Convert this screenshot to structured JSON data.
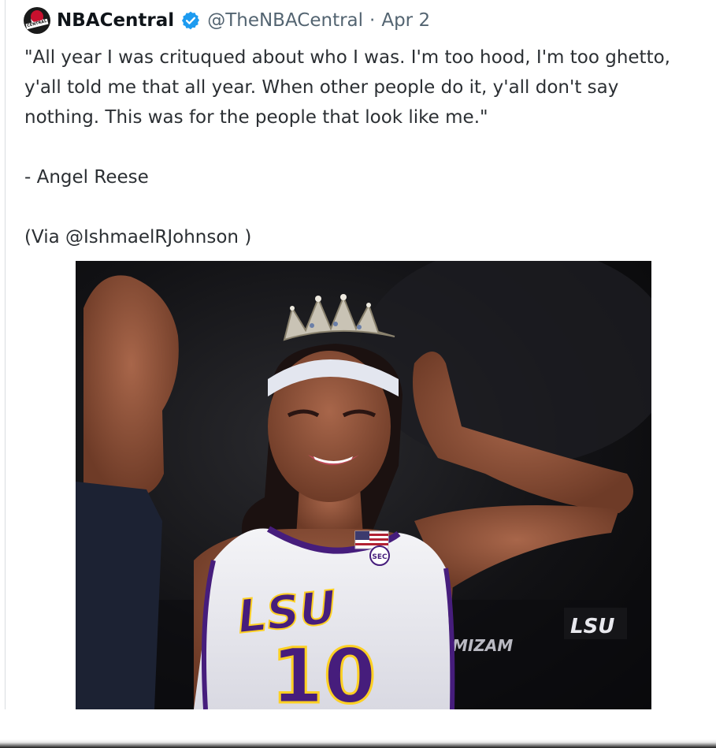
{
  "tweet": {
    "author_name": "NBACentral",
    "handle": "@TheNBACentral",
    "separator": "·",
    "date": "Apr 2",
    "avatar_text": "CENTRAL",
    "lines": [
      "\"All year I was crituqued about who I was. I'm too hood, I'm too ghetto,",
      "y'all told me that all year. When other people do it, y'all don't say",
      "nothing. This was for the people that look like me.\""
    ],
    "attribution": "-  Angel Reese",
    "via": "(Via @IshmaelRJohnson )"
  },
  "photo": {
    "jersey_team": "LSU",
    "jersey_number": "10",
    "background_sign": "LSU",
    "background_text": "MIZAM",
    "jersey_patch": "SEC"
  },
  "colors": {
    "verified_blue": "#1d9bf0",
    "lsu_purple": "#461d7c",
    "lsu_gold": "#fdd023"
  },
  "icons": {
    "verified": "verified-badge-icon"
  }
}
